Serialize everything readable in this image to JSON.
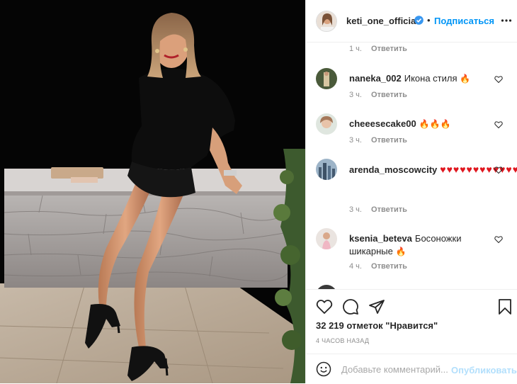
{
  "post": {
    "author": "keti_one_official",
    "separator": "•",
    "follow_label": "Подписаться",
    "more_icon": "more-options-icon",
    "verified_icon": "verified-badge-icon"
  },
  "comments": {
    "top_partial": {
      "time": "1 ч.",
      "reply": "Ответить"
    },
    "items": [
      {
        "user": "naneka_002",
        "text": "Икона стиля",
        "emoji": "🔥",
        "time": "3 ч.",
        "reply": "Ответить"
      },
      {
        "user": "cheeesecake00",
        "text": "",
        "emoji": "🔥🔥🔥",
        "time": "3 ч.",
        "reply": "Ответить"
      },
      {
        "user": "arenda_moscowcity",
        "text": "",
        "emoji": "♥♥♥♥♥♥♥♥♥♥♥♥♥♥♥♥♥♥♥♥♥♥♥♥♥♥♥♥",
        "time": "3 ч.",
        "reply": "Ответить"
      },
      {
        "user": "ksenia_beteva",
        "text": "Босоножки шикарные",
        "emoji": "🔥",
        "time": "4 ч.",
        "reply": "Ответить"
      }
    ],
    "heart_color": "#e0161e",
    "accent_blue": "#0095f6"
  },
  "actions": {
    "likes": "32 219 отметок \"Нравится\"",
    "time_ago": "4 часов назад",
    "comment_placeholder": "Добавьте комментарий...",
    "publish_label": "Опубликовать"
  }
}
